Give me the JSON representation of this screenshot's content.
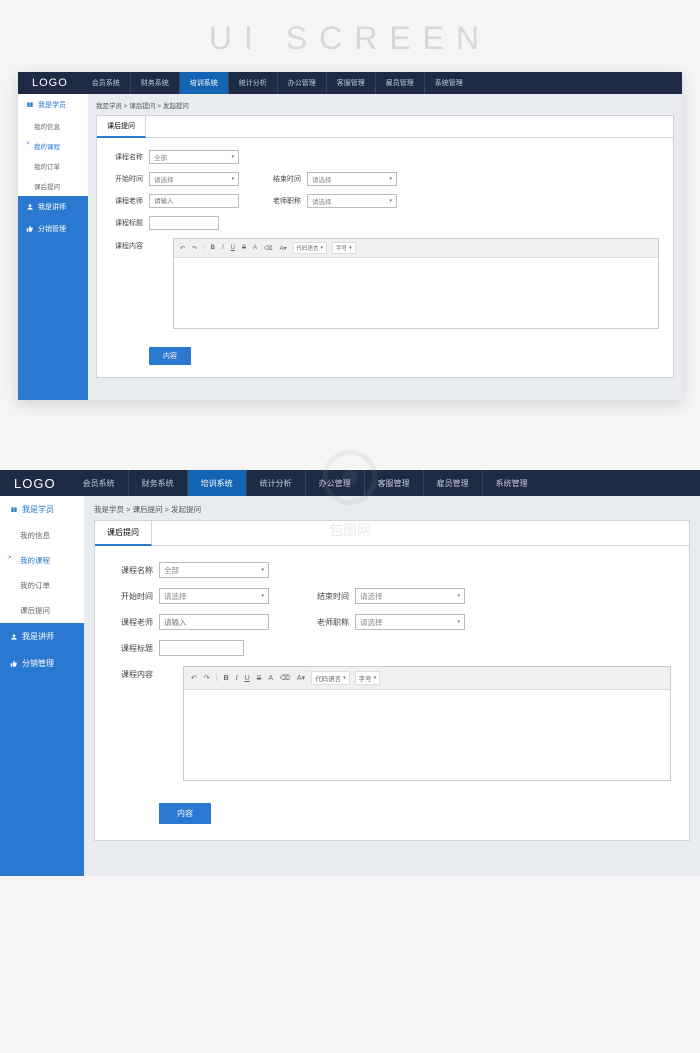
{
  "watermark_title": "UI SCREEN",
  "logo": "LOGO",
  "topnav": [
    {
      "label": "会员系统",
      "active": false
    },
    {
      "label": "财务系统",
      "active": false
    },
    {
      "label": "培训系统",
      "active": true
    },
    {
      "label": "统计分析",
      "active": false
    },
    {
      "label": "办公管理",
      "active": false
    },
    {
      "label": "客服管理",
      "active": false
    },
    {
      "label": "雇员管理",
      "active": false
    },
    {
      "label": "系统管理",
      "active": false
    }
  ],
  "sidebar": {
    "group1": {
      "label": "我是学员",
      "icon": "book"
    },
    "subs": [
      {
        "label": "我的信息",
        "active": false
      },
      {
        "label": "我的课程",
        "active": true
      },
      {
        "label": "我的订单",
        "active": false
      },
      {
        "label": "课后提问",
        "active": false
      }
    ],
    "group2": {
      "label": "我是讲师",
      "icon": "person"
    },
    "group3": {
      "label": "分销管理",
      "icon": "thumb"
    }
  },
  "breadcrumb": "我是学员 > 课后提问 > 发起提问",
  "tab": "课后提问",
  "form": {
    "course_name": {
      "label": "课程名称",
      "value": "全部"
    },
    "start_time": {
      "label": "开始时间",
      "placeholder": "请选择"
    },
    "end_time": {
      "label": "结束时间",
      "placeholder": "请选择"
    },
    "teacher": {
      "label": "课程老师",
      "placeholder": "请输入"
    },
    "teacher_title": {
      "label": "老师职称",
      "placeholder": "请选择"
    },
    "course_title": {
      "label": "课程标题"
    },
    "course_content": {
      "label": "课程内容"
    },
    "toolbar": {
      "code_lang": "代码语言",
      "font": "字号"
    },
    "submit": "内容"
  },
  "watermark_center": "包图网",
  "watermark_side": "包图"
}
